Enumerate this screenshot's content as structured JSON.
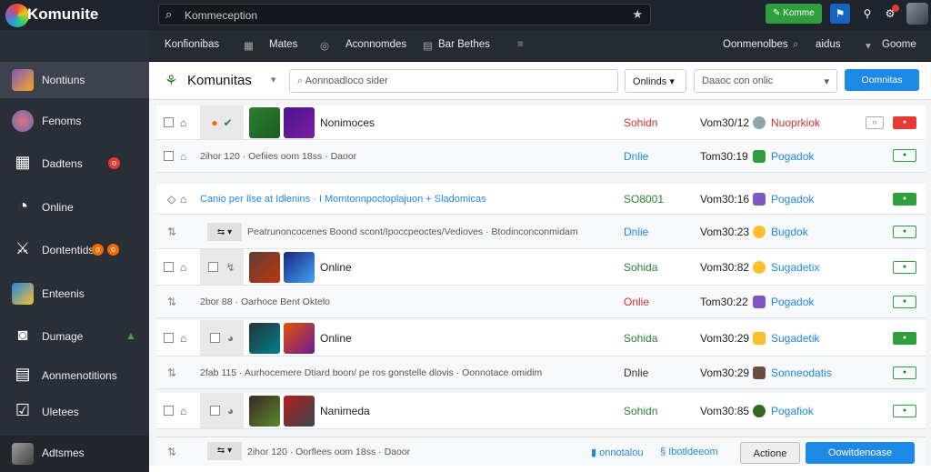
{
  "app": {
    "name": "Komunite"
  },
  "topbar": {
    "search_text": "Kommeception",
    "green_button": "Komme",
    "icons": [
      "search-icon",
      "star-icon",
      "flag-icon",
      "bell-icon",
      "notification-icon",
      "avatar"
    ]
  },
  "sidebar": {
    "items": [
      {
        "label": "Nontiuns",
        "icon": "community-icon",
        "active": true
      },
      {
        "label": "Fenoms",
        "icon": "forums-icon"
      },
      {
        "label": "Dadtens",
        "icon": "dashboard-icon",
        "badge": "o"
      },
      {
        "label": "Online",
        "icon": "clock-icon"
      },
      {
        "label": "Dontentids",
        "icon": "content-icon",
        "badge": "o",
        "badge2": "o"
      },
      {
        "label": "Enteenis",
        "icon": "events-icon"
      },
      {
        "label": "Dumage",
        "icon": "discord-icon"
      },
      {
        "label": "Aonmenotitions",
        "icon": "announcements-icon"
      },
      {
        "label": "Uletees",
        "icon": "check-icon"
      },
      {
        "label": "Adtsmes",
        "icon": "avatar-icon"
      }
    ]
  },
  "subnav": {
    "items": [
      "Konfionibas",
      "Mates",
      "Aconnomdes",
      "Bar Bethes"
    ],
    "right": [
      "Oonmenolbes",
      "aidus",
      "Goome"
    ]
  },
  "toolbar": {
    "title": "Komunitas",
    "search_placeholder": "Aonnoadloco sider",
    "filter": "Onlinds",
    "select": "Daaoc con onlic",
    "primary": "Oomnitas"
  },
  "rows": [
    {
      "kind": "main",
      "name": "Nonimoces",
      "status": "Sohidn",
      "status_color": "red",
      "time": "Vom30/12",
      "user": "Nuoprkiok",
      "user_color": "red",
      "action": "red"
    },
    {
      "kind": "sub",
      "text": "2ihor 120 · Oefiies oom 18ss · Daoor",
      "status": "Dnlie",
      "status_color": "blue",
      "time": "Tom30:19",
      "user": "Pogadok",
      "action": "outline"
    },
    {
      "kind": "link",
      "text": "Canio per Ilse at Idlenins · I Momtonnpoctoplajuon + Sladomicas",
      "status": "SO8001",
      "status_color": "green",
      "time": "Vom30:16",
      "user": "Pogadok",
      "action": "fill"
    },
    {
      "kind": "sub",
      "text": "Peatrunoncocenes Boond scont/Ipoccpeoctes/Vedioves · Btodinconconmidam",
      "status": "Dnlie",
      "status_color": "blue",
      "time": "Vom30:23",
      "user": "Bugdok",
      "action": "outline"
    },
    {
      "kind": "main",
      "name": "Online",
      "status": "Sohida",
      "status_color": "green",
      "time": "Vom30:82",
      "user": "Sugadetix",
      "action": "outline"
    },
    {
      "kind": "sub",
      "text": "2bor 88 · Oarhoce Bent Oktelo",
      "status": "Onlie",
      "status_color": "red",
      "time": "Tom30:22",
      "user": "Pogadok",
      "action": "outline"
    },
    {
      "kind": "main",
      "name": "Online",
      "status": "Sohida",
      "status_color": "green",
      "time": "Vom30:29",
      "user": "Sugadetik",
      "action": "fill"
    },
    {
      "kind": "sub",
      "text": "2fab 115 · Aurhocemere Dtiard boon/ pe ros gonstelle dlovis · Oonnotace omidim",
      "status": "Dnlie",
      "status_color": "dark",
      "time": "Vom30:29",
      "user": "Sonneodatis",
      "action": "outline"
    },
    {
      "kind": "main",
      "name": "Nanimeda",
      "status": "Sohidn",
      "status_color": "green",
      "time": "Vom30:85",
      "user": "Pogafiok",
      "action": "outline"
    }
  ],
  "bottom": {
    "text": "2ihor 120 · Oorflees oom 18ss · Daoor",
    "link1": "onnotalou",
    "link2": "Ibotldeeom",
    "secondary": "Actione",
    "primary": "Oowitdenoase"
  },
  "colors": {
    "accent": "#1e88e5",
    "green": "#2e9e3e",
    "red": "#e53935",
    "sidebar": "#2a2e36"
  }
}
